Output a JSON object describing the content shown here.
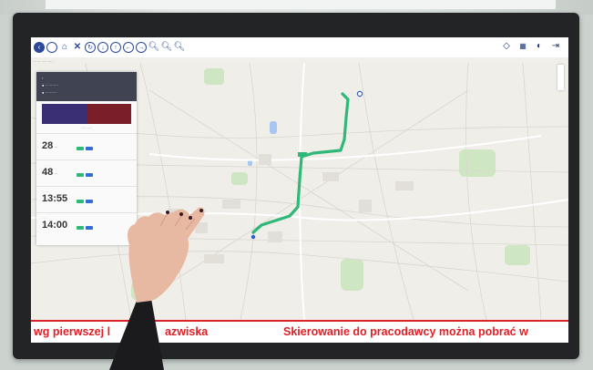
{
  "ticker": {
    "left_text": "wg pierwszej l",
    "middle_text": "azwiska",
    "right_text": "Skierowanie do pracodawcy można pobrać w"
  },
  "colors": {
    "toolbar_icon": "#2c4a98",
    "route": "#2fb878",
    "ticker_text": "#e02027",
    "panel_header": "#3f4352"
  },
  "icons": [
    "circle-left-icon",
    "circle-outline-icon",
    "home-icon",
    "close-icon",
    "refresh-icon",
    "circle-down-icon",
    "circle-up-icon",
    "circle-back-icon",
    "circle-forward-icon",
    "zoom-in-icon",
    "zoom-reset-icon",
    "zoom-out-icon",
    "tag-icon",
    "keyboard-icon",
    "contrast-icon",
    "exit-icon"
  ]
}
